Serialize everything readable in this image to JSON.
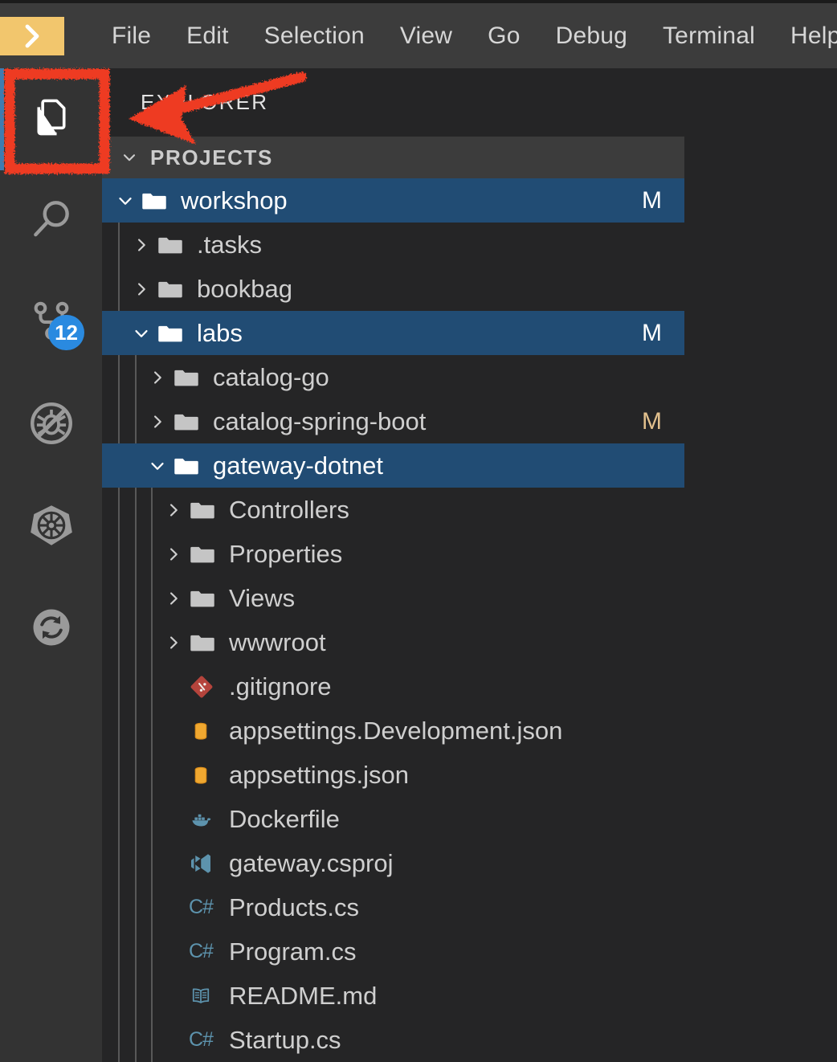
{
  "window": {
    "app": "Visual Studio Code",
    "logo_icon": "chevron-right-icon",
    "logo_bg": "#f2c66d"
  },
  "menubar": {
    "items": [
      {
        "label": "File"
      },
      {
        "label": "Edit"
      },
      {
        "label": "Selection"
      },
      {
        "label": "View"
      },
      {
        "label": "Go"
      },
      {
        "label": "Debug"
      },
      {
        "label": "Terminal"
      },
      {
        "label": "Help"
      }
    ]
  },
  "activitybar": {
    "items": [
      {
        "name": "explorer",
        "icon": "files-icon",
        "active": true,
        "badge": ""
      },
      {
        "name": "search",
        "icon": "search-icon",
        "active": false,
        "badge": ""
      },
      {
        "name": "source-control",
        "icon": "source-control-icon",
        "active": false,
        "badge": "12"
      },
      {
        "name": "debug",
        "icon": "debug-no-bug-icon",
        "active": false,
        "badge": ""
      },
      {
        "name": "kubernetes",
        "icon": "kubernetes-helm-icon",
        "active": false,
        "badge": ""
      },
      {
        "name": "sync",
        "icon": "sync-refresh-icon",
        "active": false,
        "badge": ""
      }
    ],
    "badge_color": "#2a8ae0",
    "active_indicator_color": "#3e7cb1"
  },
  "sidebar": {
    "title": "EXPLORER",
    "section": {
      "label": "PROJECTS",
      "expanded": true,
      "twisty": "chevron-down-icon"
    },
    "selected_color": "#214c74",
    "modified_badge_color": "#e2c08d",
    "tree": [
      {
        "label": "workshop",
        "type": "folder",
        "depth": 0,
        "state": "expanded",
        "selected": true,
        "badge": "M",
        "icon": "folder-open-icon"
      },
      {
        "label": ".tasks",
        "type": "folder",
        "depth": 1,
        "state": "collapsed",
        "selected": false,
        "badge": "",
        "icon": "folder-icon"
      },
      {
        "label": "bookbag",
        "type": "folder",
        "depth": 1,
        "state": "collapsed",
        "selected": false,
        "badge": "",
        "icon": "folder-icon"
      },
      {
        "label": "labs",
        "type": "folder",
        "depth": 1,
        "state": "expanded",
        "selected": true,
        "badge": "M",
        "icon": "folder-open-icon"
      },
      {
        "label": "catalog-go",
        "type": "folder",
        "depth": 2,
        "state": "collapsed",
        "selected": false,
        "badge": "",
        "icon": "folder-icon"
      },
      {
        "label": "catalog-spring-boot",
        "type": "folder",
        "depth": 2,
        "state": "collapsed",
        "selected": false,
        "badge": "M",
        "icon": "folder-icon"
      },
      {
        "label": "gateway-dotnet",
        "type": "folder",
        "depth": 2,
        "state": "expanded",
        "selected": true,
        "badge": "",
        "icon": "folder-open-icon"
      },
      {
        "label": "Controllers",
        "type": "folder",
        "depth": 3,
        "state": "collapsed",
        "selected": false,
        "badge": "",
        "icon": "folder-icon"
      },
      {
        "label": "Properties",
        "type": "folder",
        "depth": 3,
        "state": "collapsed",
        "selected": false,
        "badge": "",
        "icon": "folder-icon"
      },
      {
        "label": "Views",
        "type": "folder",
        "depth": 3,
        "state": "collapsed",
        "selected": false,
        "badge": "",
        "icon": "folder-icon"
      },
      {
        "label": "wwwroot",
        "type": "folder",
        "depth": 3,
        "state": "collapsed",
        "selected": false,
        "badge": "",
        "icon": "folder-icon"
      },
      {
        "label": ".gitignore",
        "type": "file",
        "depth": 3,
        "state": "leaf",
        "selected": false,
        "badge": "",
        "icon": "git-icon"
      },
      {
        "label": "appsettings.Development.json",
        "type": "file",
        "depth": 3,
        "state": "leaf",
        "selected": false,
        "badge": "",
        "icon": "json-icon"
      },
      {
        "label": "appsettings.json",
        "type": "file",
        "depth": 3,
        "state": "leaf",
        "selected": false,
        "badge": "",
        "icon": "json-icon"
      },
      {
        "label": "Dockerfile",
        "type": "file",
        "depth": 3,
        "state": "leaf",
        "selected": false,
        "badge": "",
        "icon": "docker-icon"
      },
      {
        "label": "gateway.csproj",
        "type": "file",
        "depth": 3,
        "state": "leaf",
        "selected": false,
        "badge": "",
        "icon": "visualstudio-icon"
      },
      {
        "label": "Products.cs",
        "type": "file",
        "depth": 3,
        "state": "leaf",
        "selected": false,
        "badge": "",
        "icon": "csharp-icon"
      },
      {
        "label": "Program.cs",
        "type": "file",
        "depth": 3,
        "state": "leaf",
        "selected": false,
        "badge": "",
        "icon": "csharp-icon"
      },
      {
        "label": "README.md",
        "type": "file",
        "depth": 3,
        "state": "leaf",
        "selected": false,
        "badge": "",
        "icon": "markdown-icon"
      },
      {
        "label": "Startup.cs",
        "type": "file",
        "depth": 3,
        "state": "leaf",
        "selected": false,
        "badge": "",
        "icon": "csharp-icon"
      }
    ]
  },
  "annotation": {
    "color": "#ee3b24",
    "highlight_target": "explorer-activity-icon",
    "shapes": [
      "rectangle-highlight",
      "arrow-pointer"
    ]
  }
}
